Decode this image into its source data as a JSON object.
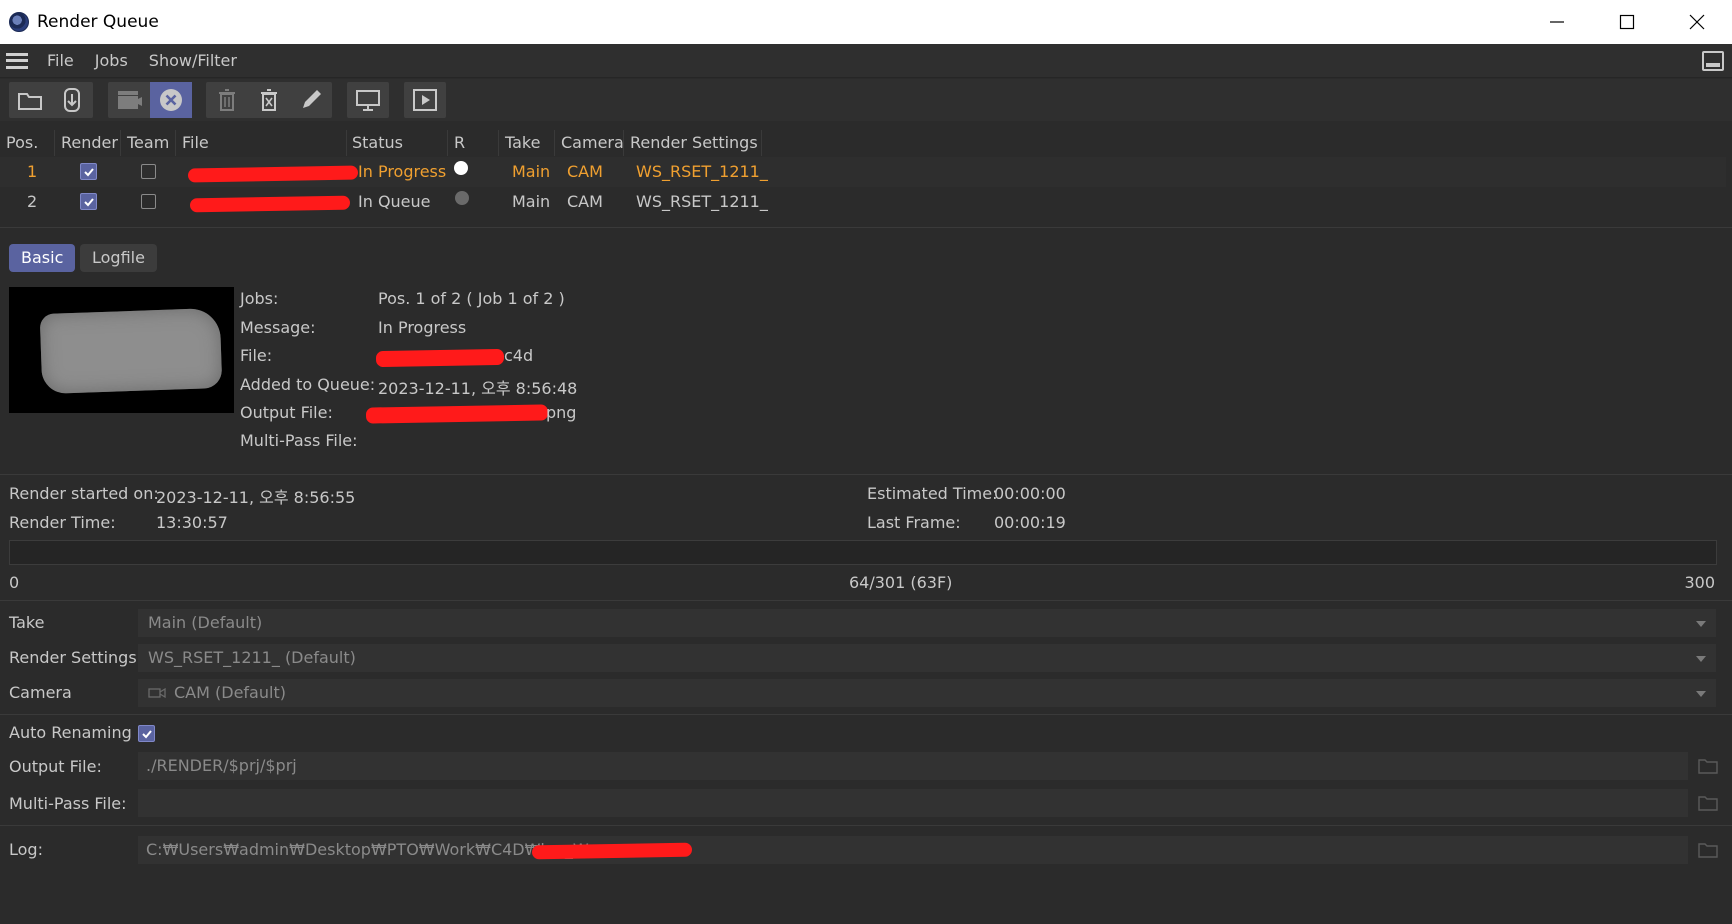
{
  "window": {
    "title": "Render Queue"
  },
  "menu": {
    "items": [
      "File",
      "Jobs",
      "Show/Filter"
    ]
  },
  "toolbar": {
    "buttons": [
      "open-folder-icon",
      "import-icon",
      "clapper-icon",
      "stop-render-icon",
      "trash-icon",
      "remove-icon",
      "edit-icon",
      "monitor-icon",
      "play-icon"
    ]
  },
  "table": {
    "headers": {
      "pos": "Pos.",
      "render": "Render",
      "team": "Team",
      "file": "File",
      "status": "Status",
      "r": "R",
      "take": "Take",
      "camera": "Camera",
      "render_settings": "Render Settings"
    },
    "rows": [
      {
        "pos": "1",
        "render": true,
        "team": false,
        "status": "In Progress",
        "r": "white",
        "take": "Main",
        "camera": "CAM",
        "render_settings": "WS_RSET_1211_"
      },
      {
        "pos": "2",
        "render": true,
        "team": false,
        "status": "In Queue",
        "r": "gray",
        "take": "Main",
        "camera": "CAM",
        "render_settings": "WS_RSET_1211_"
      }
    ]
  },
  "tabs": {
    "basic": "Basic",
    "logfile": "Logfile"
  },
  "info": {
    "jobs_label": "Jobs:",
    "jobs_value": "Pos. 1 of 2 ( Job 1 of 2 )",
    "message_label": "Message:",
    "message_value": "In Progress",
    "file_label": "File:",
    "file_value_suffix": "c4d",
    "added_label": "Added to Queue:",
    "added_value": "2023-12-11, 오후 8:56:48",
    "output_label": "Output File:",
    "output_value_suffix": "png",
    "multipass_label": "Multi-Pass File:"
  },
  "stats": {
    "render_started_label": "Render started on:",
    "render_started_value": "2023-12-11, 오후 8:56:55",
    "render_time_label": "Render Time:",
    "render_time_value": "13:30:57",
    "estimated_label": "Estimated Time:",
    "estimated_value": "00:00:00",
    "last_frame_label": "Last Frame:",
    "last_frame_value": "00:00:19"
  },
  "progress": {
    "start": "0",
    "current": "64/301 (63F)",
    "end": "300",
    "fraction": 0.0
  },
  "settings": {
    "take_label": "Take",
    "take_value": "Main (Default)",
    "render_settings_label": "Render Settings",
    "render_settings_value": "WS_RSET_1211_ (Default)",
    "camera_label": "Camera",
    "camera_value": "CAM (Default)",
    "auto_renaming_label": "Auto Renaming",
    "auto_renaming_checked": true,
    "output_label": "Output File:",
    "output_value": "./RENDER/$prj/$prj",
    "multipass_label": "Multi-Pass File:",
    "multipass_value": "",
    "log_label": "Log:",
    "log_value": "C:₩Users₩admin₩Desktop₩PTO₩Work₩C4D₩log_W"
  },
  "colors": {
    "accent": "#5a63a0",
    "in_progress": "#f0a030",
    "redaction": "#ff1a1a"
  }
}
